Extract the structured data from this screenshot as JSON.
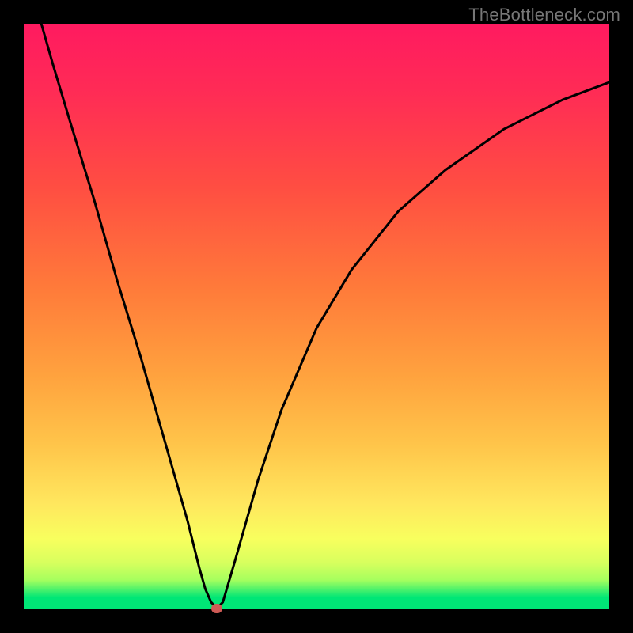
{
  "watermark": "TheBottleneck.com",
  "chart_data": {
    "type": "line",
    "title": "",
    "xlabel": "",
    "ylabel": "",
    "xlim": [
      0,
      100
    ],
    "ylim": [
      0,
      100
    ],
    "grid": false,
    "series": [
      {
        "name": "curve",
        "x": [
          3,
          5,
          8,
          12,
          16,
          20,
          24,
          28,
          30,
          31,
          32,
          33,
          34,
          36,
          40,
          44,
          50,
          56,
          64,
          72,
          82,
          92,
          100
        ],
        "y": [
          100,
          93,
          83,
          70,
          56,
          43,
          29,
          15,
          7,
          3.5,
          1.2,
          0.2,
          1.2,
          8,
          22,
          34,
          48,
          58,
          68,
          75,
          82,
          87,
          90
        ]
      }
    ],
    "marker": {
      "x": 33,
      "y": 0.2
    },
    "gradient_stops": [
      {
        "pos": 0.0,
        "color": "#00e676"
      },
      {
        "pos": 0.05,
        "color": "#a6ff5e"
      },
      {
        "pos": 0.12,
        "color": "#f8ff5e"
      },
      {
        "pos": 0.28,
        "color": "#ffc54a"
      },
      {
        "pos": 0.55,
        "color": "#ff7a3a"
      },
      {
        "pos": 0.88,
        "color": "#ff2c55"
      },
      {
        "pos": 1.0,
        "color": "#ff1a60"
      }
    ]
  }
}
